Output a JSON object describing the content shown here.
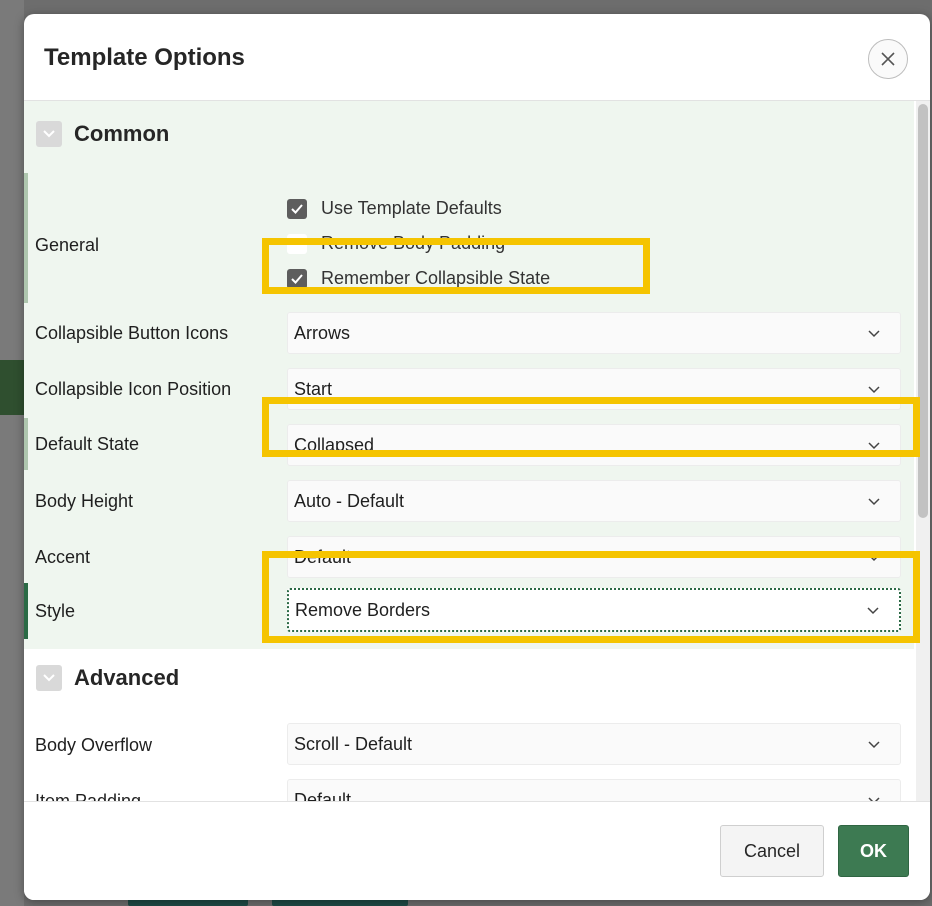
{
  "dialog": {
    "title": "Template Options",
    "close_icon": "close-icon",
    "colors": {
      "accent": "#3d7a52",
      "highlight": "#f5c400",
      "group_bg": "#eff6ef"
    }
  },
  "groups": {
    "common": {
      "title": "Common",
      "icon": "chevron-down-icon"
    },
    "advanced": {
      "title": "Advanced",
      "icon": "chevron-down-icon"
    }
  },
  "general": {
    "label": "General",
    "options": [
      {
        "label": "Use Template Defaults",
        "checked": true
      },
      {
        "label": "Remove Body Padding",
        "checked": false
      },
      {
        "label": "Remember Collapsible State",
        "checked": true
      }
    ]
  },
  "fields": [
    {
      "label": "Collapsible Button Icons",
      "value": "Arrows"
    },
    {
      "label": "Collapsible Icon Position",
      "value": "Start"
    },
    {
      "label": "Default State",
      "value": "Collapsed"
    },
    {
      "label": "Body Height",
      "value": "Auto - Default"
    },
    {
      "label": "Accent",
      "value": "Default"
    },
    {
      "label": "Style",
      "value": "Remove Borders"
    }
  ],
  "advanced_fields": [
    {
      "label": "Body Overflow",
      "value": "Scroll - Default"
    },
    {
      "label": "Item Padding",
      "value": "Default"
    }
  ],
  "footer": {
    "cancel_label": "Cancel",
    "ok_label": "OK"
  }
}
